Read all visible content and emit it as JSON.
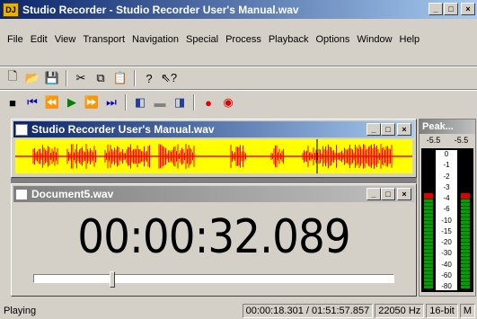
{
  "app": {
    "title": "Studio Recorder - Studio Recorder User's Manual.wav",
    "icon_text": "DJ"
  },
  "menu": [
    "File",
    "Edit",
    "View",
    "Transport",
    "Navigation",
    "Special",
    "Process",
    "Playback",
    "Options",
    "Window",
    "Help"
  ],
  "toolbar1": [
    {
      "name": "new-file-icon",
      "glyph": "🗋"
    },
    {
      "name": "open-folder-icon",
      "glyph": "📂"
    },
    {
      "name": "save-icon",
      "glyph": "💾"
    },
    {
      "sep": true
    },
    {
      "name": "cut-icon",
      "glyph": "✂"
    },
    {
      "name": "copy-icon",
      "glyph": "⧉"
    },
    {
      "name": "paste-icon",
      "glyph": "📋"
    },
    {
      "sep": true
    },
    {
      "name": "help-icon",
      "glyph": "?"
    },
    {
      "name": "context-help-icon",
      "glyph": "⇖?"
    }
  ],
  "toolbar2": [
    {
      "name": "stop-icon",
      "glyph": "■",
      "color": "#000000"
    },
    {
      "name": "go-to-start-icon",
      "glyph": "⏮",
      "color": "#0000c0"
    },
    {
      "name": "rewind-icon",
      "glyph": "⏪",
      "color": "#0000c0"
    },
    {
      "name": "play-icon",
      "glyph": "▶",
      "color": "#008000"
    },
    {
      "name": "fast-forward-icon",
      "glyph": "⏩",
      "color": "#0000c0"
    },
    {
      "name": "go-to-end-icon",
      "glyph": "⏭",
      "color": "#0000c0"
    },
    {
      "sep": true
    },
    {
      "name": "mark-in-icon",
      "glyph": "◧",
      "color": "#2040a0"
    },
    {
      "name": "loop-icon",
      "glyph": "▬",
      "color": "#808080"
    },
    {
      "name": "mark-out-icon",
      "glyph": "◨",
      "color": "#2040a0"
    },
    {
      "sep": true
    },
    {
      "name": "record-icon",
      "glyph": "●",
      "color": "#e00000"
    },
    {
      "name": "record-pause-icon",
      "glyph": "◉",
      "color": "#e00000"
    }
  ],
  "wave_window": {
    "title": "Studio Recorder User's Manual.wav"
  },
  "doc_window": {
    "title": "Document5.wav",
    "time": "00:00:32.089"
  },
  "peak": {
    "title": "Peak...",
    "left": "-5.5",
    "right": "-5.5",
    "scale": [
      "0",
      "-1",
      "-2",
      "-3",
      "-4",
      "-6",
      "-10",
      "-15",
      "-20",
      "-30",
      "-40",
      "-60",
      "-80"
    ],
    "level_left": 0.66,
    "level_right": 0.66
  },
  "caption_buttons": {
    "min": "_",
    "max": "□",
    "close": "×"
  },
  "status": {
    "state": "Playing",
    "position": "00:00:18.301 / 01:51:57.857",
    "rate": "22050 Hz",
    "bits": "16-bit",
    "mode": "M"
  },
  "colors": {
    "wave_bg": "#ffff00",
    "wave_fg": "#ff0000",
    "meter_green": "#00a000",
    "meter_red": "#e00000",
    "meter_yellow": "#e0e000"
  }
}
